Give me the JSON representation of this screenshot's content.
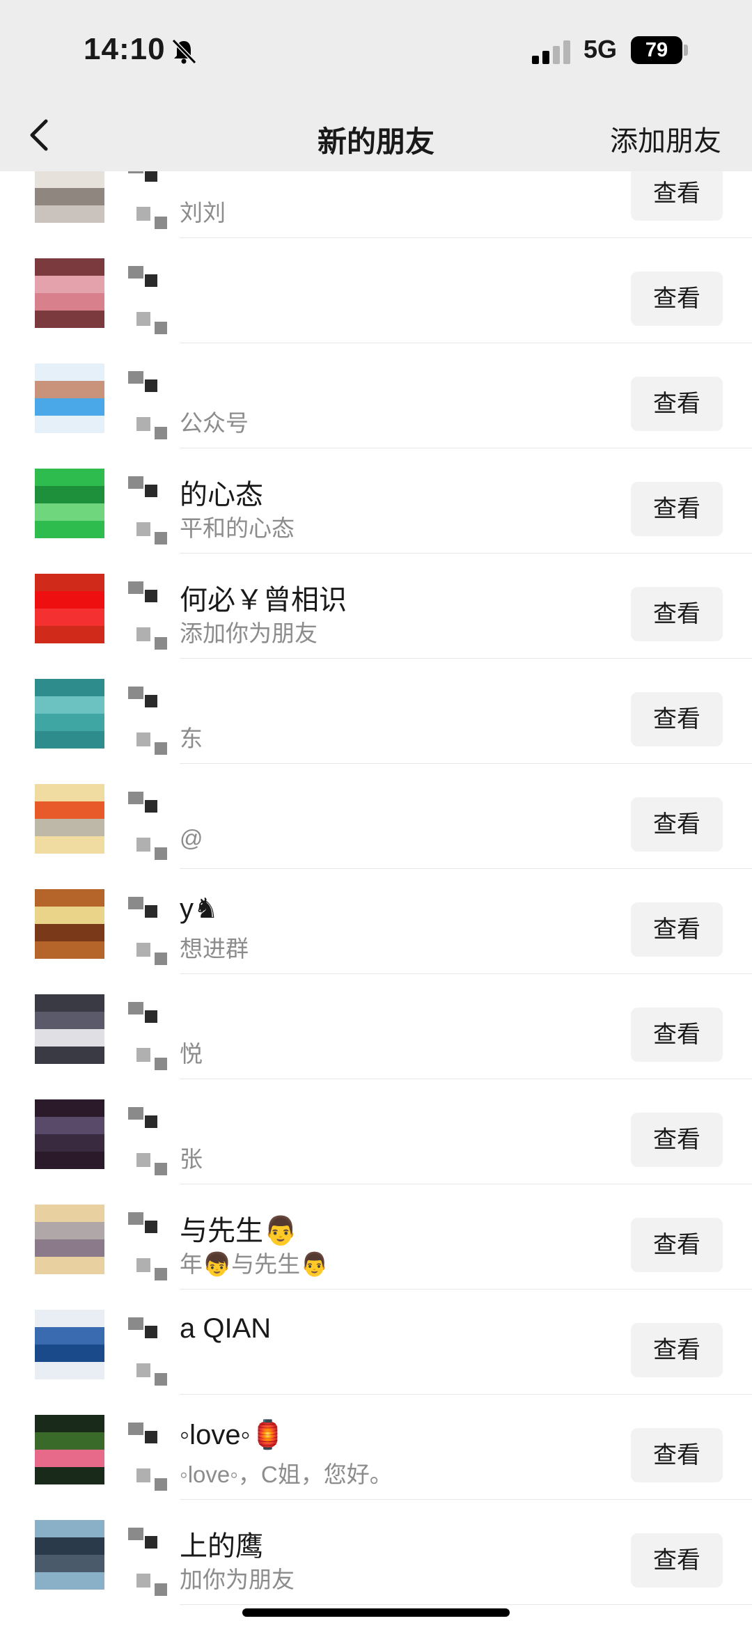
{
  "status_bar": {
    "time": "14:10",
    "network": "5G",
    "battery": "79"
  },
  "nav": {
    "title": "新的朋友",
    "right_action": "添加朋友"
  },
  "rows": [
    {
      "name": "",
      "sub": "刘刘",
      "button": "查看",
      "colors": [
        "#c9c2bd",
        "#8f8680",
        "#e7e1dc"
      ]
    },
    {
      "name": "",
      "sub": "",
      "button": "查看",
      "colors": [
        "#e4a2ad",
        "#7a3a3e",
        "#d8808c"
      ]
    },
    {
      "name": "",
      "sub": "公众号",
      "button": "查看",
      "colors": [
        "#4aa8e8",
        "#c9927a",
        "#e6f0f8"
      ]
    },
    {
      "name": "的心态",
      "sub": "平和的心态",
      "button": "查看",
      "colors": [
        "#2fbc4e",
        "#6fd67e",
        "#1e8f3a"
      ]
    },
    {
      "name": "何必￥曾相识",
      "sub": "添加你为朋友",
      "button": "查看",
      "colors": [
        "#ee1010",
        "#d02a1a",
        "#f43030"
      ]
    },
    {
      "name": "",
      "sub": "东",
      "button": "查看",
      "colors": [
        "#3fa6a4",
        "#6bc2c0",
        "#2f8c8c"
      ]
    },
    {
      "name": "",
      "sub": "@",
      "button": "查看",
      "colors": [
        "#f0dba0",
        "#bdb8a8",
        "#e85a2a"
      ]
    },
    {
      "name": "y♞",
      "sub": "想进群",
      "button": "查看",
      "colors": [
        "#e9d48a",
        "#b5652a",
        "#7a3a1a"
      ]
    },
    {
      "name": "",
      "sub": "悦",
      "button": "查看",
      "colors": [
        "#e0e0e4",
        "#5b5a6a",
        "#3a3a44"
      ]
    },
    {
      "name": "",
      "sub": "张",
      "button": "查看",
      "colors": [
        "#2a1a2a",
        "#3a2a40",
        "#5a4a6a"
      ]
    },
    {
      "name": "与先生👨",
      "sub": "年👦与先生👨",
      "button": "查看",
      "colors": [
        "#b0a8a8",
        "#e8d0a0",
        "#8a7a8a"
      ]
    },
    {
      "name": "a QIAN",
      "sub": "",
      "button": "查看",
      "colors": [
        "#1a4a8a",
        "#3a6ab0",
        "#e8eef4"
      ]
    },
    {
      "name": "◦love◦🏮",
      "sub": "◦love◦，C姐，您好。",
      "button": "查看",
      "colors": [
        "#1a2a1a",
        "#e86a8a",
        "#3a6a2a"
      ]
    },
    {
      "name": "上的鹰",
      "sub": "加你为朋友",
      "button": "查看",
      "colors": [
        "#2a3a4a",
        "#8ab0c8",
        "#4a5a6a"
      ]
    }
  ]
}
